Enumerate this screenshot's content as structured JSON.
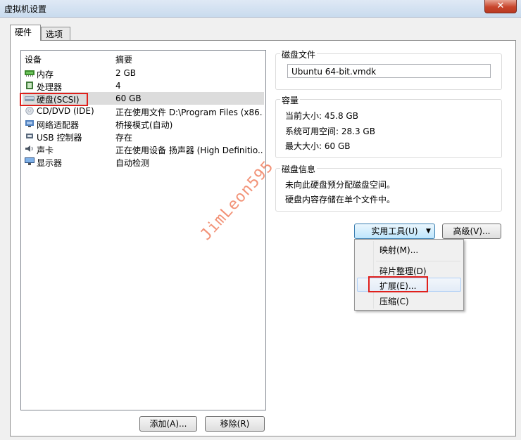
{
  "window": {
    "title": "虚拟机设置",
    "close_label": "✕"
  },
  "tabs": [
    {
      "label": "硬件"
    },
    {
      "label": "选项"
    }
  ],
  "device_list": {
    "headers": {
      "device": "设备",
      "summary": "摘要"
    },
    "rows": [
      {
        "name": "内存",
        "summary": "2 GB",
        "icon": "memory-icon"
      },
      {
        "name": "处理器",
        "summary": "4",
        "icon": "processor-icon"
      },
      {
        "name": "硬盘(SCSI)",
        "summary": "60 GB",
        "icon": "hard-disk-icon"
      },
      {
        "name": "CD/DVD (IDE)",
        "summary": "正在使用文件 D:\\Program Files (x86...",
        "icon": "cd-dvd-icon"
      },
      {
        "name": "网络适配器",
        "summary": "桥接模式(自动)",
        "icon": "network-adapter-icon"
      },
      {
        "name": "USB 控制器",
        "summary": "存在",
        "icon": "usb-icon"
      },
      {
        "name": "声卡",
        "summary": "正在使用设备 扬声器 (High Definitio...",
        "icon": "sound-card-icon"
      },
      {
        "name": "显示器",
        "summary": "自动检测",
        "icon": "display-icon"
      }
    ],
    "add_button": "添加(A)...",
    "remove_button": "移除(R)"
  },
  "disk_file": {
    "title": "磁盘文件",
    "value": "Ubuntu 64-bit.vmdk"
  },
  "capacity": {
    "title": "容量",
    "current_size": "当前大小: 45.8 GB",
    "free_space": "系统可用空间: 28.3 GB",
    "max_size": "最大大小: 60 GB"
  },
  "disk_info": {
    "title": "磁盘信息",
    "line1": "未向此硬盘预分配磁盘空间。",
    "line2": "硬盘内容存储在单个文件中。"
  },
  "utilities_button": "实用工具(U)",
  "advanced_button": "高级(V)...",
  "utilities_menu": [
    {
      "label": "映射(M)..."
    },
    {
      "label": "碎片整理(D)"
    },
    {
      "label": "扩展(E)..."
    },
    {
      "label": "压缩(C)"
    }
  ],
  "watermark": "JimLeon595",
  "colors": {
    "highlight_box": "#e0201c",
    "watermark": "#f08060"
  }
}
